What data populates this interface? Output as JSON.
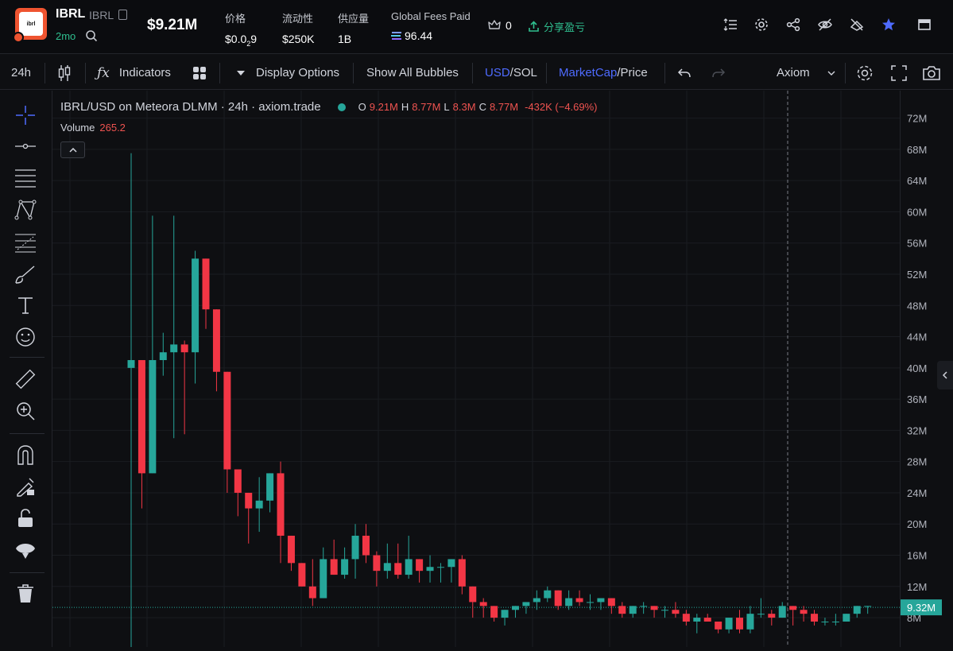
{
  "token": {
    "name": "IBRL",
    "symbol": "IBRL",
    "logo_text": "ibrl",
    "age": "2mo",
    "market_cap": "$9.21M"
  },
  "stats": [
    {
      "label": "价格",
      "value_html": "$0.0",
      "value_sub": "2",
      "value_tail": "9"
    },
    {
      "label": "流动性",
      "value": "$250K"
    },
    {
      "label": "供应量",
      "value": "1B"
    },
    {
      "label": "Global Fees Paid",
      "value": "96.44"
    }
  ],
  "holders": "0",
  "pnl_label": "分享盈亏",
  "toolbar": {
    "interval": "24h",
    "indicators": "Indicators",
    "display_options": "Display Options",
    "show_bubbles": "Show All Bubbles",
    "currency_active": "USD",
    "currency_sep": "/",
    "currency_other": "SOL",
    "metric_active": "MarketCap",
    "metric_sep": "/",
    "metric_other": "Price",
    "preset": "Axiom"
  },
  "legend": {
    "title": "IBRL/USD on Meteora DLMM · 24h · axiom.trade",
    "o_label": "O",
    "o": "9.21M",
    "h_label": "H",
    "h": "8.77M",
    "l_label": "L",
    "l": "8.3M",
    "c_label": "C",
    "c": "8.77M",
    "change": "-432K (−4.69%)",
    "volume_label": "Volume",
    "volume": "265.2"
  },
  "price_axis": {
    "ticks": [
      "72M",
      "68M",
      "64M",
      "60M",
      "56M",
      "52M",
      "48M",
      "44M",
      "40M",
      "36M",
      "32M",
      "28M",
      "24M",
      "20M",
      "16M",
      "12M",
      "8M"
    ],
    "current": "9.32M"
  },
  "colors": {
    "up": "#26a69a",
    "down": "#f23645",
    "accent": "#4e6bff",
    "green_text": "#2fbf8f"
  },
  "chart_data": {
    "type": "candlestick",
    "ylim": [
      4,
      74
    ],
    "current_price": 9.32,
    "candles": [
      [
        40,
        67.5,
        4,
        41
      ],
      [
        41,
        41,
        22,
        26.5
      ],
      [
        26.5,
        59.5,
        26.5,
        41
      ],
      [
        41,
        44.5,
        39,
        42
      ],
      [
        42,
        59.5,
        31,
        43
      ],
      [
        43,
        43.5,
        31.5,
        42
      ],
      [
        42,
        55,
        38,
        54
      ],
      [
        54,
        54,
        45,
        47.5
      ],
      [
        47.5,
        47.5,
        37,
        39.5
      ],
      [
        39.5,
        39.5,
        24,
        27
      ],
      [
        27,
        27,
        21,
        24
      ],
      [
        24,
        24,
        17.5,
        22
      ],
      [
        22,
        26,
        19,
        23
      ],
      [
        23,
        26.5,
        21.5,
        26.5
      ],
      [
        26.5,
        28,
        15,
        18.5
      ],
      [
        18.5,
        18.5,
        14,
        15
      ],
      [
        15,
        15,
        12,
        12
      ],
      [
        12,
        15.5,
        9.5,
        10.5
      ],
      [
        10.5,
        17,
        10.5,
        15.5
      ],
      [
        15.5,
        18,
        13.5,
        13.5
      ],
      [
        13.5,
        17,
        13,
        15.5
      ],
      [
        15.5,
        20,
        13,
        18.5
      ],
      [
        18.5,
        20,
        15,
        16
      ],
      [
        16,
        16.5,
        12,
        14
      ],
      [
        14,
        17.5,
        13,
        15
      ],
      [
        15,
        17.5,
        13,
        13.5
      ],
      [
        13.5,
        18.5,
        13,
        15.5
      ],
      [
        15.5,
        15.5,
        12.5,
        14
      ],
      [
        14,
        16,
        12.5,
        14.5
      ],
      [
        14.5,
        15,
        12.5,
        14.5
      ],
      [
        14.5,
        15.5,
        12.5,
        15.5
      ],
      [
        15.5,
        16,
        11,
        12
      ],
      [
        12,
        12,
        8,
        10
      ],
      [
        10,
        10.5,
        8,
        9.5
      ],
      [
        9.5,
        9.5,
        7.5,
        8
      ],
      [
        8,
        9,
        7,
        9
      ],
      [
        9,
        9.5,
        8,
        9.5
      ],
      [
        9.5,
        10,
        8.5,
        10
      ],
      [
        10,
        11.5,
        9,
        10.5
      ],
      [
        10.5,
        12,
        10,
        11.5
      ],
      [
        11.5,
        11.5,
        9,
        9.5
      ],
      [
        9.5,
        11.5,
        9,
        10.5
      ],
      [
        10.5,
        11.5,
        9.5,
        10
      ],
      [
        10,
        11,
        9,
        10
      ],
      [
        10,
        10.5,
        9,
        10.5
      ],
      [
        10.5,
        10.5,
        8.5,
        9.5
      ],
      [
        9.5,
        10,
        8,
        8.5
      ],
      [
        8.5,
        9.5,
        8,
        9.5
      ],
      [
        9.5,
        10,
        8.5,
        9.5
      ],
      [
        9.5,
        9.5,
        8,
        9
      ],
      [
        9,
        9.5,
        8,
        9
      ],
      [
        9,
        10,
        8,
        8.5
      ],
      [
        8.5,
        9,
        7,
        7.5
      ],
      [
        7.5,
        8.5,
        6,
        8
      ],
      [
        8,
        8.5,
        7.5,
        7.5
      ],
      [
        7.5,
        7.5,
        6,
        6.5
      ],
      [
        6.5,
        8,
        6,
        8
      ],
      [
        8,
        9,
        6,
        6.5
      ],
      [
        6.5,
        9.5,
        6,
        8.5
      ],
      [
        8.5,
        10.5,
        8,
        8.5
      ],
      [
        8.5,
        9,
        7,
        8
      ],
      [
        8,
        10,
        8,
        9.5
      ],
      [
        9.5,
        9.5,
        7,
        9
      ],
      [
        9,
        9.5,
        7.5,
        8.5
      ],
      [
        8.5,
        9,
        7,
        7.5
      ],
      [
        7.5,
        8,
        7,
        7.5
      ],
      [
        7.5,
        8.5,
        7,
        7.5
      ],
      [
        7.5,
        8.5,
        7.5,
        8.5
      ],
      [
        8.5,
        9.5,
        8,
        9.5
      ],
      [
        9.5,
        9.5,
        8.5,
        9.5
      ]
    ]
  }
}
